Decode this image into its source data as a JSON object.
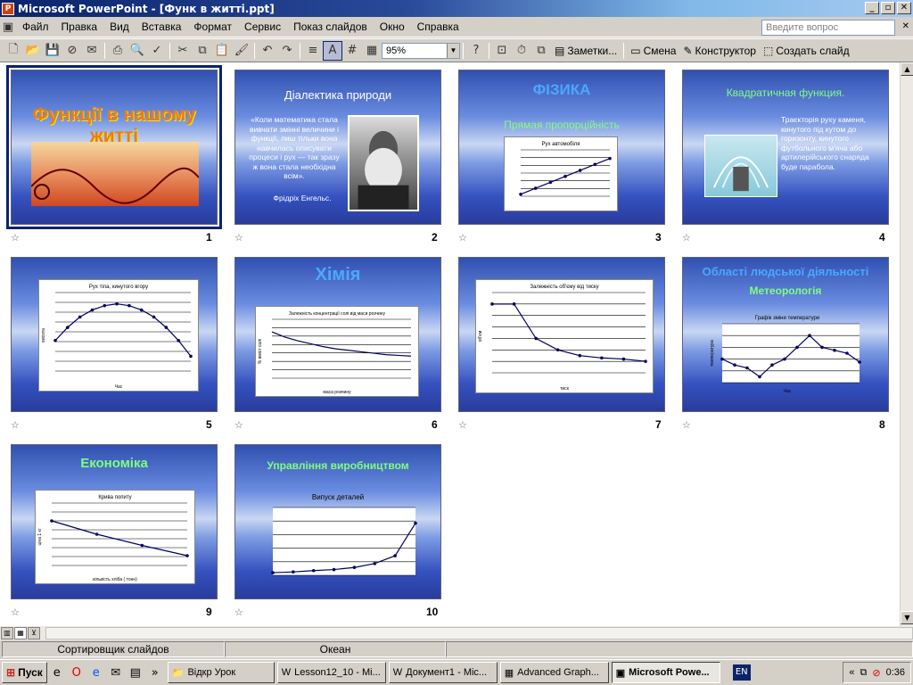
{
  "window": {
    "title": "Microsoft PowerPoint - [Функ в житті.ppt]",
    "app_icon": "ppt-icon",
    "minimize": "_",
    "maximize": "▫",
    "close": "✕"
  },
  "menu": {
    "items": [
      "Файл",
      "Правка",
      "Вид",
      "Вставка",
      "Формат",
      "Сервис",
      "Показ слайдов",
      "Окно",
      "Справка"
    ],
    "help_placeholder": "Введите вопрос",
    "doc_close": "✕"
  },
  "toolbar": {
    "zoom": "95%",
    "notes": "Заметки...",
    "layout": "Смена",
    "design": "Конструктор",
    "new_slide": "Создать слайд"
  },
  "slides": [
    {
      "num": "1",
      "title": "Функції в нашому житті"
    },
    {
      "num": "2",
      "title": "Діалектика природи",
      "body": "«Коли математика стала вивчати змінні величини і функції, лиш тільки вона навчилась описувати процеси і рух — так зразу ж вона стала необхідна всім».",
      "author": "Фрідріх Енгельс."
    },
    {
      "num": "3",
      "title": "ФІЗИКА",
      "subtitle": "Прямая пропорційність",
      "chart_title": "Рух автомобіля"
    },
    {
      "num": "4",
      "title": "Квадратичная функция.",
      "body": "Траєкторія руху каменя, кинутого під кутом до горизонту, кинутого футбольного м'яча або артилерійського снаряда буде парабола."
    },
    {
      "num": "5",
      "chart_title": "Рух тіла, кинутого вгору",
      "xlabel": "Час",
      "ylabel": "висота"
    },
    {
      "num": "6",
      "title": "Хімія",
      "chart_title": "Залежність концентрації солі від маси розчину",
      "xlabel": "маса розчину",
      "ylabel": "% вміст солі"
    },
    {
      "num": "7",
      "chart_title": "Залежність об'єму від тиску",
      "xlabel": "тиск",
      "ylabel": "об'єм"
    },
    {
      "num": "8",
      "title": "Області людської діяльності",
      "subtitle": "Метеорологія",
      "chart_title": "Графік зміни температури",
      "xlabel": "Час",
      "ylabel": "температура"
    },
    {
      "num": "9",
      "title": "Економіка",
      "chart_title": "Крива попиту",
      "xlabel": "кількість хліба ( тонн)",
      "ylabel": "ціна 1 кг"
    },
    {
      "num": "10",
      "title": "Управління виробництвом",
      "chart_title": "Випуск деталей"
    }
  ],
  "status": {
    "view": "Сортировщик слайдов",
    "design": "Океан"
  },
  "taskbar": {
    "start": "Пуск",
    "tasks": [
      "Відкр Урок",
      "Lesson12_10 - Mi...",
      "Документ1 - Mic...",
      "Advanced Graph...",
      "Microsoft Powe..."
    ],
    "lang": "EN",
    "clock": "0:36"
  },
  "colors": {
    "titlebar": "#0a246a",
    "selection": "#0a246a",
    "slide_dark": "#283c9c",
    "title_green": "#7fff7f",
    "title_blue": "#4aa8ff"
  }
}
